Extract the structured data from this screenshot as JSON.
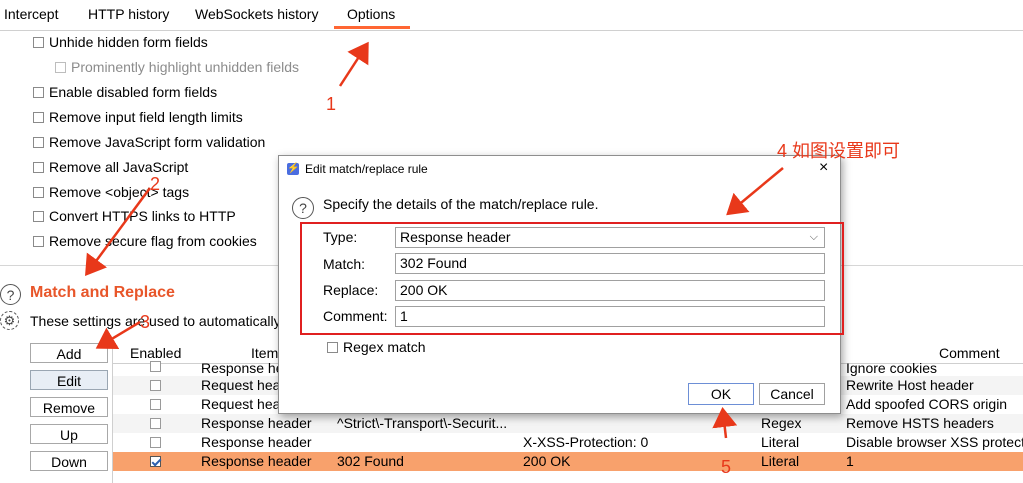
{
  "tabs": [
    {
      "label": "Intercept",
      "active": false
    },
    {
      "label": "HTTP history",
      "active": false
    },
    {
      "label": "WebSockets history",
      "active": false
    },
    {
      "label": "Options",
      "active": true
    }
  ],
  "options": [
    {
      "label": "Unhide hidden form fields",
      "enabled": true
    },
    {
      "label": "Prominently highlight unhidden fields",
      "enabled": false
    },
    {
      "label": "Enable disabled form fields",
      "enabled": true
    },
    {
      "label": "Remove input field length limits",
      "enabled": true
    },
    {
      "label": "Remove JavaScript form validation",
      "enabled": true
    },
    {
      "label": "Remove all JavaScript",
      "enabled": true
    },
    {
      "label": "Remove <object> tags",
      "enabled": true
    },
    {
      "label": "Convert HTTPS links to HTTP",
      "enabled": true
    },
    {
      "label": "Remove secure flag from cookies",
      "enabled": true
    }
  ],
  "match_replace": {
    "title": "Match and Replace",
    "description": "These settings are used to automatically",
    "buttons": {
      "add": "Add",
      "edit": "Edit",
      "remove": "Remove",
      "up": "Up",
      "down": "Down"
    },
    "columns": {
      "enabled": "Enabled",
      "item": "Item",
      "comment": "Comment"
    },
    "rows": [
      {
        "checked": false,
        "item": "Response header",
        "match": "",
        "replace": "",
        "type": "",
        "comment": "Ignore cookies"
      },
      {
        "checked": false,
        "item": "Request header",
        "match": "",
        "replace": "",
        "type": "",
        "comment": "Rewrite Host header"
      },
      {
        "checked": false,
        "item": "Request header",
        "match": "",
        "replace": "",
        "type": "",
        "comment": "Add spoofed CORS origin"
      },
      {
        "checked": false,
        "item": "Response header",
        "match": "^Strict\\-Transport\\-Securit...",
        "replace": "",
        "type": "Regex",
        "comment": "Remove HSTS headers"
      },
      {
        "checked": false,
        "item": "Response header",
        "match": "",
        "replace": "X-XSS-Protection: 0",
        "type": "Literal",
        "comment": "Disable browser XSS protect"
      },
      {
        "checked": true,
        "item": "Response header",
        "match": "302 Found",
        "replace": "200 OK",
        "type": "Literal",
        "comment": "1"
      }
    ]
  },
  "dialog": {
    "title": "Edit match/replace rule",
    "description": "Specify the details of the match/replace rule.",
    "fields": {
      "type_label": "Type:",
      "type_value": "Response header",
      "match_label": "Match:",
      "match_value": "302 Found",
      "replace_label": "Replace:",
      "replace_value": "200 OK",
      "comment_label": "Comment:",
      "comment_value": "1"
    },
    "regex_label": "Regex match",
    "ok_label": "OK",
    "cancel_label": "Cancel",
    "close_glyph": "×"
  },
  "annotations": {
    "n1": "1",
    "n2": "2",
    "n3": "3",
    "n4": "4 如图设置即可",
    "n5": "5"
  },
  "colors": {
    "accent": "#e8562a",
    "annotation": "#e8381a",
    "selected_row": "#f8a16c"
  }
}
